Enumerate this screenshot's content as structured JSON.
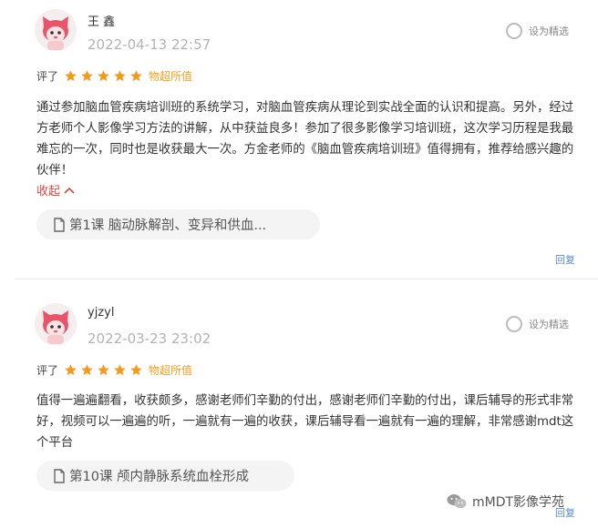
{
  "reviews": [
    {
      "username": "王 鑫",
      "date": "2022-04-13 22:57",
      "featured_label": "设为精选",
      "rating_label": "评了",
      "stars": 5,
      "grade": "物超所值",
      "content": "通过参加脑血管疾病培训班的系统学习，对脑血管疾病从理论到实战全面的认识和提高。另外，经过方老师个人影像学习方法的讲解，从中获益良多！参加了很多影像学习培训班，这次学习历程是我最难忘的一次，同时也是收获最大一次。方金老师的《脑血管疾病培训班》值得拥有，推荐给感兴趣的伙伴！",
      "collapse_label": "收起",
      "lesson": "第1课 脑动脉解剖、变异和供血...",
      "reply_label": "回复"
    },
    {
      "username": "yjzyl",
      "date": "2022-03-23 23:02",
      "featured_label": "设为精选",
      "rating_label": "评了",
      "stars": 5,
      "grade": "物超所值",
      "content": "值得一遍遍翻看，收获颇多，感谢老师们辛勤的付出，感谢老师们辛勤的付出，课后辅导的形式非常好，视频可以一遍遍的听，一遍就有一遍的收获，课后辅导看一遍就有一遍的理解，非常感谢mdt这个平台",
      "lesson": "第10课 颅内静脉系统血栓形成",
      "reply_label": "回复"
    }
  ],
  "watermark": "mMDT影像学苑",
  "colors": {
    "star": "#f39a1e",
    "grade": "#f0a020",
    "collapse": "#e04646",
    "reply": "#5b8ac2"
  }
}
